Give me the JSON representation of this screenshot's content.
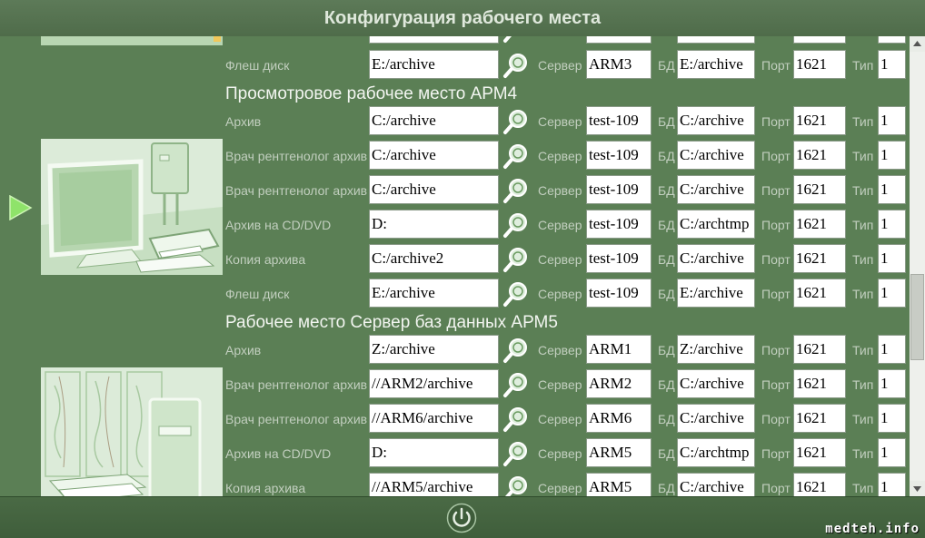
{
  "window": {
    "title": "Конфигурация рабочего места"
  },
  "labels": {
    "server": "Сервер",
    "db": "БД",
    "port": "Порт",
    "type": "Тип"
  },
  "icons": {
    "lookup": "magnifier-icon",
    "power": "power-icon",
    "selected": "play-arrow-icon"
  },
  "colors": {
    "background": "#5b7f55",
    "bar": "#4f6c4a",
    "arrow": "#8fe36a"
  },
  "top_partial": {
    "path": "",
    "server": "",
    "db": "",
    "port": "",
    "type": ""
  },
  "arm3_tail": {
    "label": "Флеш диск",
    "path": "E:/archive",
    "server": "ARM3",
    "db": "E:/archive",
    "port": "1621",
    "type": "1"
  },
  "sections": [
    {
      "title": "Просмотровое рабочее место АРМ4",
      "rows": [
        {
          "label": "Архив",
          "path": "C:/archive",
          "server": "test-109",
          "db": "C:/archive",
          "port": "1621",
          "type": "1"
        },
        {
          "label": "Врач рентгенолог архив",
          "path": "C:/archive",
          "server": "test-109",
          "db": "C:/archive",
          "port": "1621",
          "type": "1"
        },
        {
          "label": "Врач рентгенолог архив",
          "path": "C:/archive",
          "server": "test-109",
          "db": "C:/archive",
          "port": "1621",
          "type": "1"
        },
        {
          "label": "Архив на CD/DVD",
          "path": "D:",
          "server": "test-109",
          "db": "C:/archtmp",
          "port": "1621",
          "type": "1"
        },
        {
          "label": "Копия архива",
          "path": "C:/archive2",
          "server": "test-109",
          "db": "C:/archive",
          "port": "1621",
          "type": "1"
        },
        {
          "label": "Флеш диск",
          "path": "E:/archive",
          "server": "test-109",
          "db": "E:/archive",
          "port": "1621",
          "type": "1"
        }
      ]
    },
    {
      "title": "Рабочее место Сервер баз данных АРМ5",
      "rows": [
        {
          "label": "Архив",
          "path": "Z:/archive",
          "server": "ARM1",
          "db": "Z:/archive",
          "port": "1621",
          "type": "1"
        },
        {
          "label": "Врач рентгенолог архив",
          "path": "//ARM2/archive",
          "server": "ARM2",
          "db": "C:/archive",
          "port": "1621",
          "type": "1"
        },
        {
          "label": "Врач рентгенолог архив",
          "path": "//ARM6/archive",
          "server": "ARM6",
          "db": "C:/archive",
          "port": "1621",
          "type": "1"
        },
        {
          "label": "Архив на CD/DVD",
          "path": "D:",
          "server": "ARM5",
          "db": "C:/archtmp",
          "port": "1621",
          "type": "1"
        },
        {
          "label": "Копия архива",
          "path": "//ARM5/archive",
          "server": "ARM5",
          "db": "C:/archive",
          "port": "1621",
          "type": "1"
        }
      ]
    }
  ],
  "watermark": "medteh.info"
}
